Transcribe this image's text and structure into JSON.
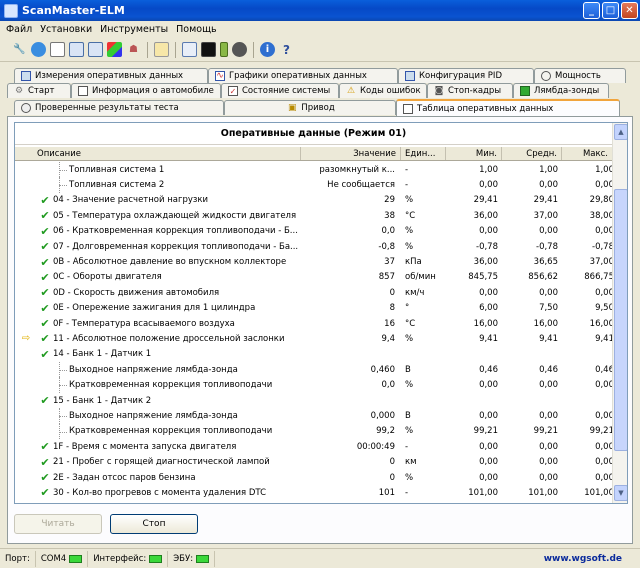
{
  "window": {
    "title": "ScanMaster-ELM"
  },
  "menu": [
    "Файл",
    "Установки",
    "Инструменты",
    "Помощь"
  ],
  "toolbar_icons": [
    "wrench-icon",
    "globe-icon",
    "document-icon",
    "grid-icon",
    "grid-icon",
    "chart-icon",
    "person-icon",
    "copy-icon",
    "window-icon",
    "terminal-icon",
    "battery-icon",
    "gear-icon",
    "info-icon",
    "help-icon"
  ],
  "tabs": {
    "row1": [
      "Измерения оперативных данных",
      "Графики оперативных данных",
      "Конфигурация PID",
      "Мощность"
    ],
    "row2": [
      "Старт",
      "Информация о автомобиле",
      "Состояние системы",
      "Коды ошибок",
      "Стоп-кадры",
      "Лямбда-зонды"
    ],
    "row3": [
      "Проверенные результаты теста",
      "Привод",
      "Таблица оперативных данных"
    ]
  },
  "grid": {
    "title": "Оперативные данные (Режим 01)",
    "headers": [
      "Описание",
      "Значение",
      "Един...",
      "Мин.",
      "Средн.",
      "Макс."
    ],
    "rows": [
      {
        "desc": "Топливная система 1",
        "val": "разомкнутый к...",
        "unit": "-",
        "min": "1,00",
        "avg": "1,00",
        "max": "1,00",
        "check": false,
        "sub": true,
        "arrow": false
      },
      {
        "desc": "Топливная система 2",
        "val": "Не сообщается",
        "unit": "-",
        "min": "0,00",
        "avg": "0,00",
        "max": "0,00",
        "check": false,
        "sub": true,
        "arrow": false
      },
      {
        "desc": "04 - Значение расчетной нагрузки",
        "val": "29",
        "unit": "%",
        "min": "29,41",
        "avg": "29,41",
        "max": "29,80",
        "check": true,
        "sub": false,
        "arrow": false
      },
      {
        "desc": "05 - Температура охлаждающей жидкости двигателя",
        "val": "38",
        "unit": "°C",
        "min": "36,00",
        "avg": "37,00",
        "max": "38,00",
        "check": true,
        "sub": false,
        "arrow": false
      },
      {
        "desc": "06 - Кратковременная коррекция топливоподачи - Б...",
        "val": "0,0",
        "unit": "%",
        "min": "0,00",
        "avg": "0,00",
        "max": "0,00",
        "check": true,
        "sub": false,
        "arrow": false
      },
      {
        "desc": "07 - Долговременная коррекция топливоподачи - Ба...",
        "val": "-0,8",
        "unit": "%",
        "min": "-0,78",
        "avg": "-0,78",
        "max": "-0,78",
        "check": true,
        "sub": false,
        "arrow": false
      },
      {
        "desc": "0B - Абсолютное давление во впускном коллекторе",
        "val": "37",
        "unit": "кПа",
        "min": "36,00",
        "avg": "36,65",
        "max": "37,00",
        "check": true,
        "sub": false,
        "arrow": false
      },
      {
        "desc": "0C - Обороты двигателя",
        "val": "857",
        "unit": "об/мин",
        "min": "845,75",
        "avg": "856,62",
        "max": "866,75",
        "check": true,
        "sub": false,
        "arrow": false
      },
      {
        "desc": "0D - Скорость движения автомобиля",
        "val": "0",
        "unit": "км/ч",
        "min": "0,00",
        "avg": "0,00",
        "max": "0,00",
        "check": true,
        "sub": false,
        "arrow": false
      },
      {
        "desc": "0E - Опережение зажигания для 1 цилиндра",
        "val": "8",
        "unit": "°",
        "min": "6,00",
        "avg": "7,50",
        "max": "9,50",
        "check": true,
        "sub": false,
        "arrow": false
      },
      {
        "desc": "0F - Температура всасываемого воздуха",
        "val": "16",
        "unit": "°C",
        "min": "16,00",
        "avg": "16,00",
        "max": "16,00",
        "check": true,
        "sub": false,
        "arrow": false
      },
      {
        "desc": "11 - Абсолютное положение дроссельной заслонки",
        "val": "9,4",
        "unit": "%",
        "min": "9,41",
        "avg": "9,41",
        "max": "9,41",
        "check": true,
        "sub": false,
        "arrow": true
      },
      {
        "desc": "14 - Банк 1 - Датчик 1",
        "val": "",
        "unit": "",
        "min": "",
        "avg": "",
        "max": "",
        "check": true,
        "sub": false,
        "arrow": false
      },
      {
        "desc": "Выходное напряжение лямбда-зонда",
        "val": "0,460",
        "unit": "В",
        "min": "0,46",
        "avg": "0,46",
        "max": "0,46",
        "check": false,
        "sub": true,
        "arrow": false
      },
      {
        "desc": "Кратковременная коррекция топливоподачи",
        "val": "0,0",
        "unit": "%",
        "min": "0,00",
        "avg": "0,00",
        "max": "0,00",
        "check": false,
        "sub": true,
        "arrow": false
      },
      {
        "desc": "15 - Банк 1 - Датчик 2",
        "val": "",
        "unit": "",
        "min": "",
        "avg": "",
        "max": "",
        "check": true,
        "sub": false,
        "arrow": false
      },
      {
        "desc": "Выходное напряжение лямбда-зонда",
        "val": "0,000",
        "unit": "В",
        "min": "0,00",
        "avg": "0,00",
        "max": "0,00",
        "check": false,
        "sub": true,
        "arrow": false
      },
      {
        "desc": "Кратковременная коррекция топливоподачи",
        "val": "99,2",
        "unit": "%",
        "min": "99,21",
        "avg": "99,21",
        "max": "99,21",
        "check": false,
        "sub": true,
        "arrow": false
      },
      {
        "desc": "1F - Время с момента запуска двигателя",
        "val": "00:00:49",
        "unit": "-",
        "min": "0,00",
        "avg": "0,00",
        "max": "0,00",
        "check": true,
        "sub": false,
        "arrow": false
      },
      {
        "desc": "21 - Пробег с горящей диагностической лампой",
        "val": "0",
        "unit": "км",
        "min": "0,00",
        "avg": "0,00",
        "max": "0,00",
        "check": true,
        "sub": false,
        "arrow": false
      },
      {
        "desc": "2E - Задан отсос паров бензина",
        "val": "0",
        "unit": "%",
        "min": "0,00",
        "avg": "0,00",
        "max": "0,00",
        "check": true,
        "sub": false,
        "arrow": false
      },
      {
        "desc": "30 - Кол-во прогревов с момента удаления DTC",
        "val": "101",
        "unit": "-",
        "min": "101,00",
        "avg": "101,00",
        "max": "101,00",
        "check": true,
        "sub": false,
        "arrow": false
      }
    ]
  },
  "buttons": {
    "read": "Читать",
    "stop": "Стоп"
  },
  "status": {
    "port_label": "Порт:",
    "port_value": "COM4",
    "interface_label": "Интерфейс:",
    "ecu_label": "ЭБУ:",
    "url": "www.wgsoft.de"
  },
  "colors": {
    "accent": "#f1a43c",
    "check": "#1f9a1f",
    "led": "#3bd83b",
    "title_bar": "#0a5fdb"
  }
}
